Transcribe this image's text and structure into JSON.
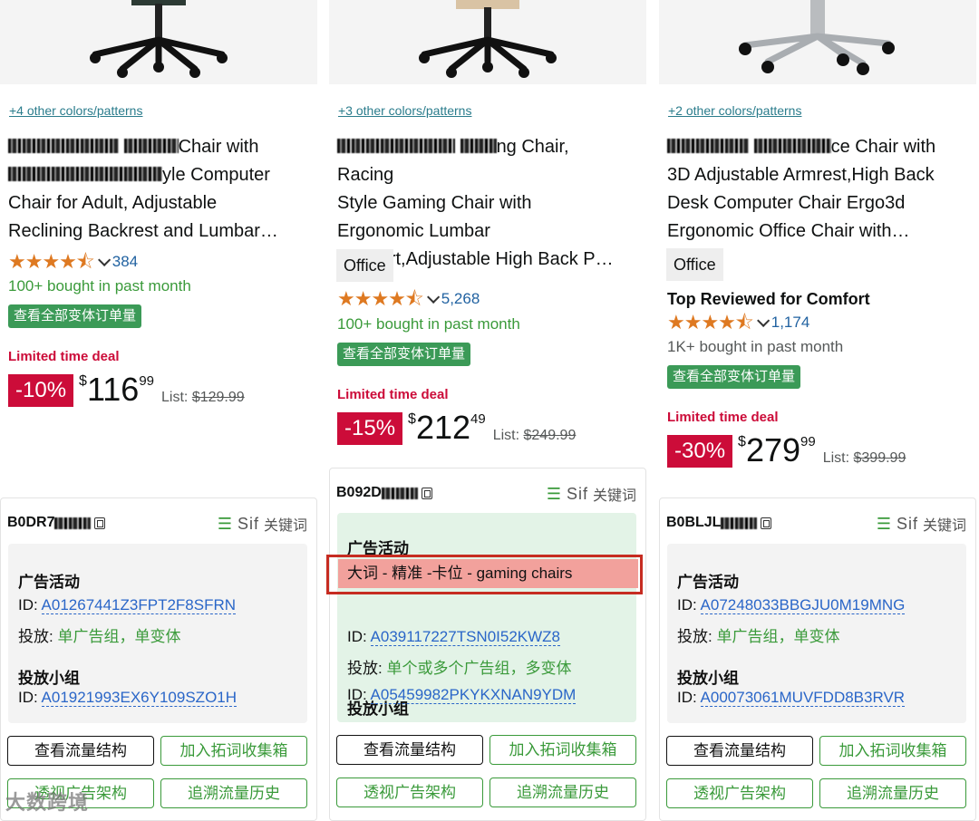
{
  "products": [
    {
      "colors_link": "+4 other colors/patterns",
      "title_line1": "Chair with",
      "title_line2": "yle Computer",
      "title_line3": "Chair for Adult, Adjustable",
      "title_line4": "Reclining Backrest and Lumbar…",
      "rating_value": 4.5,
      "review_count": "384",
      "bought": "100+ bought in past month",
      "variant_button": "查看全部变体订单量",
      "deal_label": "Limited time deal",
      "discount": "-10%",
      "currency": "$",
      "price_whole": "116",
      "price_fraction": "99",
      "list_label": "List:",
      "list_price": "$129.99",
      "card": {
        "asin": "B0DR7",
        "sif_name": "Sif",
        "sif_label": "关键词",
        "campaign_heading": "广告活动",
        "campaign_id_label": "ID:",
        "campaign_id": "A01267441Z3FPT2F8SFRN",
        "placement_label": "投放:",
        "placement_value": "单广告组，单变体",
        "group_heading": "投放小组",
        "group_id_label": "ID:",
        "group_id": "A01921993EX6Y109SZO1H",
        "btn_traffic": "查看流量结构",
        "btn_add_kw": "加入拓词收集箱",
        "btn_ad_arch": "透视广告架构",
        "btn_history": "追溯流量历史"
      }
    },
    {
      "colors_link": "+3 other colors/patterns",
      "title_line1": "ng Chair, Racing",
      "title_line2": "Style Gaming Chair with",
      "title_line3": "Ergonomic Lumbar",
      "title_line4": "Support,Adjustable High Back P…",
      "office_label": "Office",
      "rating_value": 4.5,
      "review_count": "5,268",
      "bought": "100+ bought in past month",
      "variant_button": "查看全部变体订单量",
      "deal_label": "Limited time deal",
      "discount": "-15%",
      "currency": "$",
      "price_whole": "212",
      "price_fraction": "49",
      "list_label": "List:",
      "list_price": "$249.99",
      "card": {
        "asin": "B092D",
        "sif_name": "Sif",
        "sif_label": "关键词",
        "campaign_heading": "广告活动",
        "campaign_name": "大词 - 精准 -卡位 - gaming chairs",
        "campaign_id_label": "ID:",
        "campaign_id": "A039117227TSN0I52KWZ8",
        "placement_label": "投放:",
        "placement_value": "单个或多个广告组，多变体",
        "group_heading": "投放小组",
        "group_id_label": "ID:",
        "group_id": "A05459982PKYKXNAN9YDM",
        "btn_traffic": "查看流量结构",
        "btn_add_kw": "加入拓词收集箱",
        "btn_ad_arch": "透视广告架构",
        "btn_history": "追溯流量历史"
      }
    },
    {
      "colors_link": "+2 other colors/patterns",
      "title_line1": "ce Chair with",
      "title_line2": "3D Adjustable Armrest,High Back",
      "title_line3": "Desk Computer Chair Ergo3d",
      "title_line4": "Ergonomic Office Chair with…",
      "office_label": "Office",
      "top_reviewed": "Top Reviewed for Comfort",
      "rating_value": 4.5,
      "review_count": "1,174",
      "bought": "1K+ bought in past month",
      "variant_button": "查看全部变体订单量",
      "deal_label": "Limited time deal",
      "discount": "-30%",
      "currency": "$",
      "price_whole": "279",
      "price_fraction": "99",
      "list_label": "List:",
      "list_price": "$399.99",
      "card": {
        "asin": "B0BLJL",
        "sif_name": "Sif",
        "sif_label": "关键词",
        "campaign_heading": "广告活动",
        "campaign_id_label": "ID:",
        "campaign_id": "A07248033BBGJU0M19MNG",
        "placement_label": "投放:",
        "placement_value": "单广告组，单变体",
        "group_heading": "投放小组",
        "group_id_label": "ID:",
        "group_id": "A00073061MUVFDD8B3RVR",
        "btn_traffic": "查看流量结构",
        "btn_add_kw": "加入拓词收集箱",
        "btn_ad_arch": "透视广告架构",
        "btn_history": "追溯流量历史"
      }
    }
  ],
  "watermark": "大数跨境",
  "icons": {
    "stars": "star-rating-icon",
    "chevron": "chevron-down-icon",
    "copy": "copy-icon",
    "menu": "list-menu-icon"
  },
  "colors": {
    "deal_red": "#cc0c39",
    "star_orange": "#de7921",
    "link_blue": "#2162a1",
    "green": "#3a9a3a",
    "highlight": "#f2a19c",
    "frame_red": "#c62c21"
  }
}
